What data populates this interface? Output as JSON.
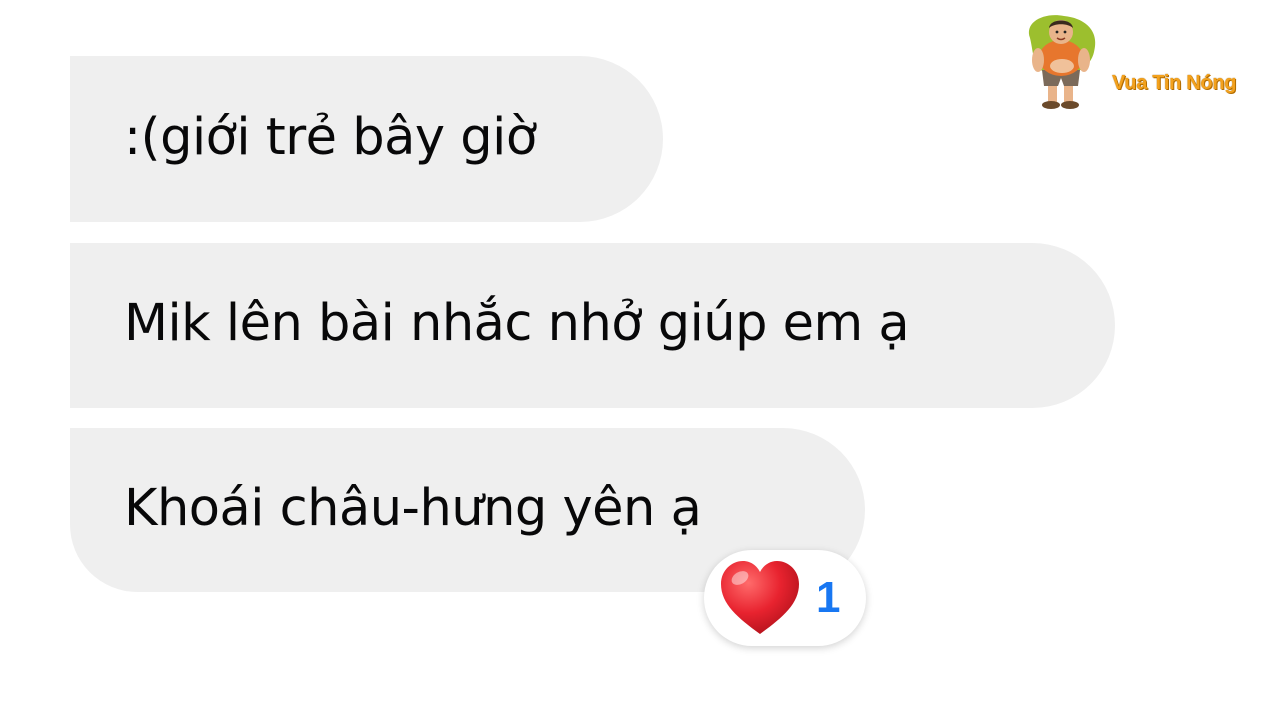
{
  "messages": [
    {
      "text": ":(giới trẻ bây giờ"
    },
    {
      "text": "Mik lên bài nhắc nhở giúp em ạ"
    },
    {
      "text": "Khoái châu-hưng yên ạ"
    }
  ],
  "reaction": {
    "icon": "heart-icon",
    "count": "1",
    "heart_color": "#e8232f",
    "count_color": "#1877f2"
  },
  "watermark": {
    "text": "Vua Tin Nóng",
    "text_color": "#f3a11d"
  },
  "colors": {
    "bubble": "#efefef",
    "text": "#080809",
    "background": "#ffffff"
  }
}
